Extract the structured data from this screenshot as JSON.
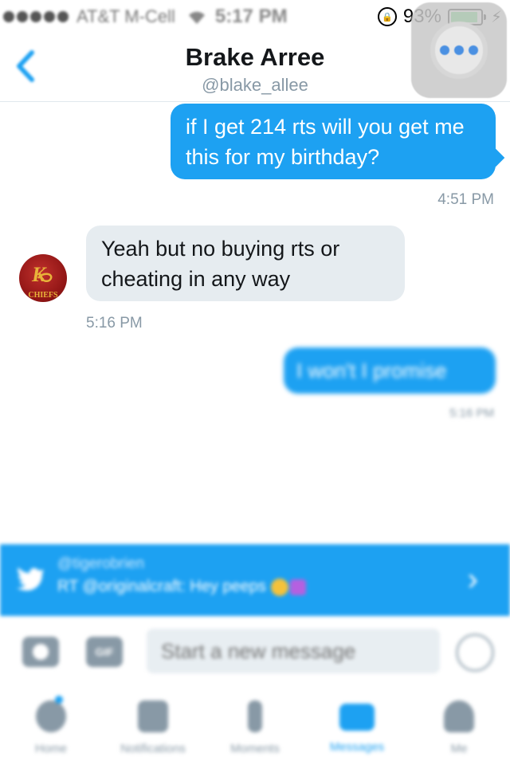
{
  "status_bar": {
    "carrier": "AT&T M-Cell",
    "time": "5:17 PM",
    "battery_percent": "93%",
    "battery_level": 0.93,
    "icons": [
      "signal-dots-icon",
      "wifi-icon",
      "orientation-lock-icon",
      "battery-icon",
      "charging-bolt-icon"
    ]
  },
  "header": {
    "back_icon": "chevron-left-icon",
    "name": "Brake Arree",
    "handle": "@blake_allee"
  },
  "assistive_touch": {
    "icon": "more-dots-icon"
  },
  "messages": [
    {
      "direction": "outgoing",
      "text": "if I get 214 rts will you get me this for my birthday?",
      "time": "4:51 PM"
    },
    {
      "direction": "incoming",
      "avatar_text": "CHIEFS",
      "text": "Yeah but no buying rts or cheating in any way",
      "time": "5:16 PM"
    },
    {
      "direction": "outgoing",
      "text": "I won't I promise",
      "time": "5:16 PM"
    }
  ],
  "notification": {
    "icon": "twitter-bird-icon",
    "title": "@tigerobrien",
    "text": "RT @originalcraft: Hey peeps"
  },
  "composer": {
    "placeholder": "Start a new message",
    "icons": [
      "camera-icon",
      "gif-icon",
      "send-icon"
    ],
    "gif_label": "GIF"
  },
  "tabs": [
    {
      "label": "Home",
      "icon": "home-icon"
    },
    {
      "label": "Notifications",
      "icon": "bell-icon"
    },
    {
      "label": "Moments",
      "icon": "lightning-icon"
    },
    {
      "label": "Messages",
      "icon": "envelope-icon",
      "active": true
    },
    {
      "label": "Me",
      "icon": "person-icon"
    }
  ],
  "colors": {
    "accent": "#1da1f2",
    "incoming_bubble": "#e6ecf0",
    "secondary_text": "#8899a6",
    "battery": "#4cd964"
  }
}
